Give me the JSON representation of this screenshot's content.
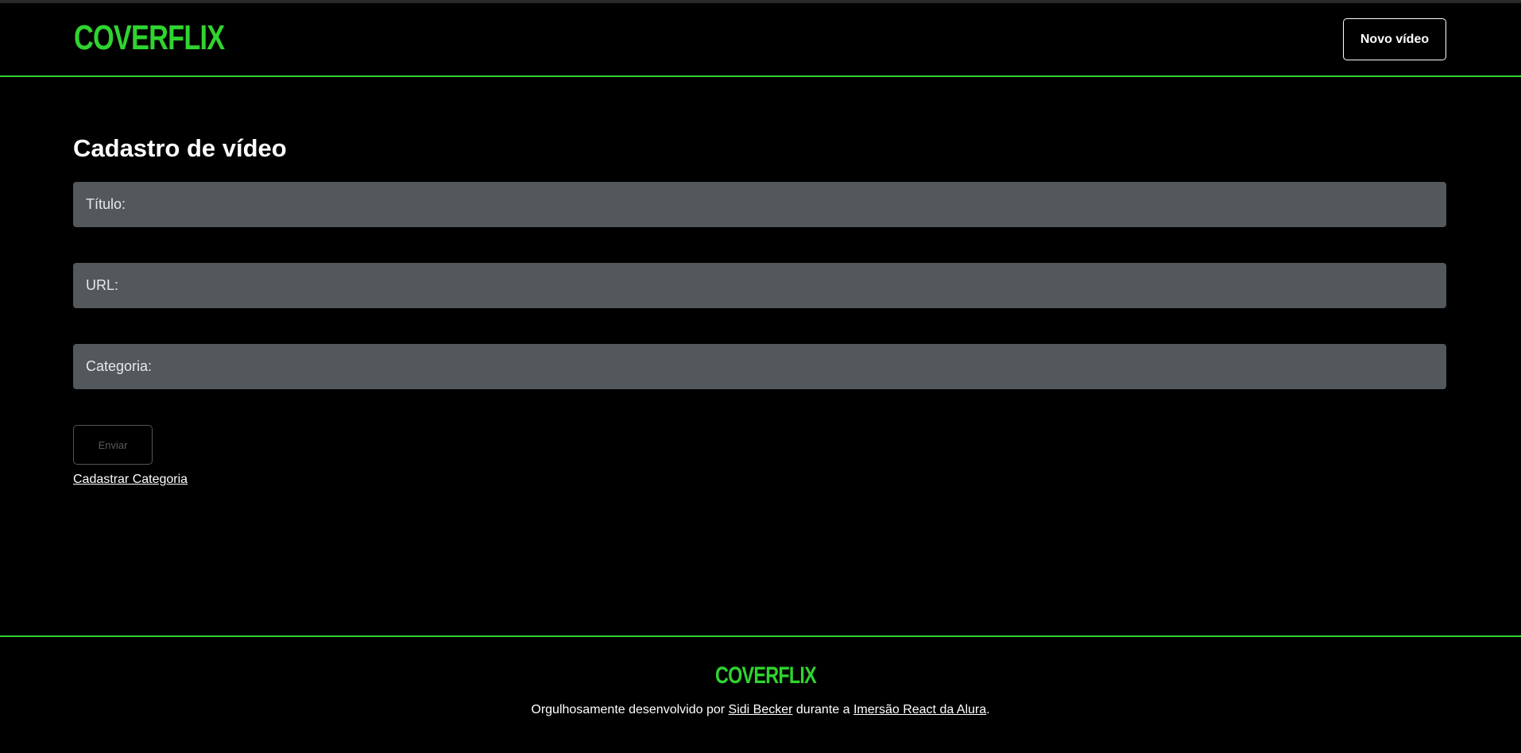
{
  "header": {
    "logo_text": "COVERFLIX",
    "new_video_label": "Novo vídeo"
  },
  "main": {
    "title": "Cadastro de vídeo",
    "fields": [
      {
        "label": "Título:",
        "value": ""
      },
      {
        "label": "URL:",
        "value": ""
      },
      {
        "label": "Categoria:",
        "value": ""
      }
    ],
    "submit_label": "Enviar",
    "category_link": "Cadastrar Categoria"
  },
  "footer": {
    "logo_text": "COVERFLIX",
    "text_before": "Orgulhosamente desenvolvido por ",
    "author_link": "Sidi Becker",
    "text_middle": " durante a ",
    "event_link": "Imersão React da Alura",
    "text_after": "."
  },
  "colors": {
    "accent": "#2fd42f",
    "background": "#000000",
    "field_bg": "#53585d",
    "text": "#ffffff"
  }
}
